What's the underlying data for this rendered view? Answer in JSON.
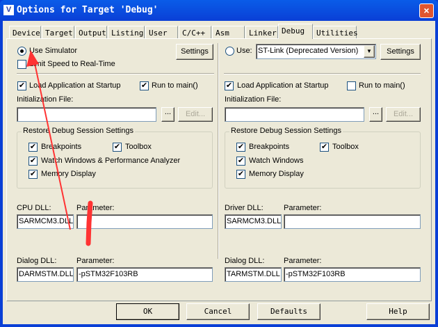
{
  "window": {
    "title": "Options for Target 'Debug'",
    "close": "×",
    "icon": "uv-logo"
  },
  "tabs": [
    "Device",
    "Target",
    "Output",
    "Listing",
    "User",
    "C/C++",
    "Asm",
    "Linker",
    "Debug",
    "Utilities"
  ],
  "left": {
    "use_simulator": "Use Simulator",
    "settings": "Settings",
    "limit_speed": "Limit Speed to Real-Time",
    "load_app": "Load Application at Startup",
    "run_to_main": "Run to main()",
    "init_file_label": "Initialization File:",
    "init_file_value": "",
    "browse": "...",
    "edit": "Edit...",
    "restore_group": "Restore Debug Session Settings",
    "breakpoints": "Breakpoints",
    "toolbox": "Toolbox",
    "watch": "Watch Windows & Performance Analyzer",
    "memory": "Memory Display",
    "cpu_dll_label": "CPU DLL:",
    "cpu_dll": "SARMCM3.DLL",
    "param_label": "Parameter:",
    "cpu_param": "",
    "dialog_dll_label": "Dialog DLL:",
    "dialog_dll": "DARMSTM.DLL",
    "dialog_param": "-pSTM32F103RB"
  },
  "right": {
    "use": "Use:",
    "driver": "ST-Link (Deprecated Version)",
    "settings": "Settings",
    "load_app": "Load Application at Startup",
    "run_to_main": "Run to main()",
    "init_file_label": "Initialization File:",
    "init_file_value": "",
    "browse": "...",
    "edit": "Edit...",
    "restore_group": "Restore Debug Session Settings",
    "breakpoints": "Breakpoints",
    "toolbox": "Toolbox",
    "watch": "Watch Windows",
    "memory": "Memory Display",
    "driver_dll_label": "Driver DLL:",
    "driver_dll": "SARMCM3.DLL",
    "param_label": "Parameter:",
    "driver_param": "",
    "dialog_dll_label": "Dialog DLL:",
    "dialog_dll": "TARMSTM.DLL",
    "dialog_param": "-pSTM32F103RB"
  },
  "buttons": {
    "ok": "OK",
    "cancel": "Cancel",
    "defaults": "Defaults",
    "help": "Help"
  },
  "annotation_color": "#ff3333"
}
